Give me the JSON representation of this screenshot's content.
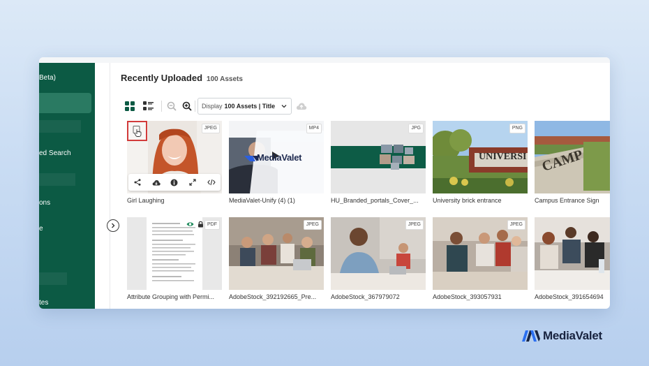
{
  "sidebar": {
    "items": [
      {
        "label": "Beta)"
      },
      {
        "label": "ed Search"
      },
      {
        "label": "ons"
      },
      {
        "label": "e"
      },
      {
        "label": "tes"
      }
    ]
  },
  "header": {
    "title": "Recently Uploaded",
    "count": "100 Assets"
  },
  "toolbar": {
    "display_prefix": "Display",
    "display_value": "100 Assets | Title"
  },
  "assets": [
    {
      "name": "Girl Laughing",
      "type": "JPEG"
    },
    {
      "name": "MediaValet-Unify (4) (1)",
      "type": "MP4",
      "overlay_text": "MediaValet"
    },
    {
      "name": "HU_Branded_portals_Cover_...",
      "type": "JPG"
    },
    {
      "name": "University brick entrance",
      "type": "PNG",
      "sign_text": "UNIVERSI"
    },
    {
      "name": "Campus Entrance Sign",
      "type": "",
      "sign_text": "CAMP"
    },
    {
      "name": "Attribute Grouping with Permi...",
      "type": "PDF"
    },
    {
      "name": "AdobeStock_392192665_Pre...",
      "type": "JPEG"
    },
    {
      "name": "AdobeStock_367979072",
      "type": "JPEG"
    },
    {
      "name": "AdobeStock_393057931",
      "type": "JPEG"
    },
    {
      "name": "AdobeStock_391654694",
      "type": ""
    }
  ],
  "brand": {
    "name": "MediaValet",
    "accent": "#0c5a44",
    "highlight": "#d23b3b",
    "logo_blue": "#2b6ff0"
  }
}
